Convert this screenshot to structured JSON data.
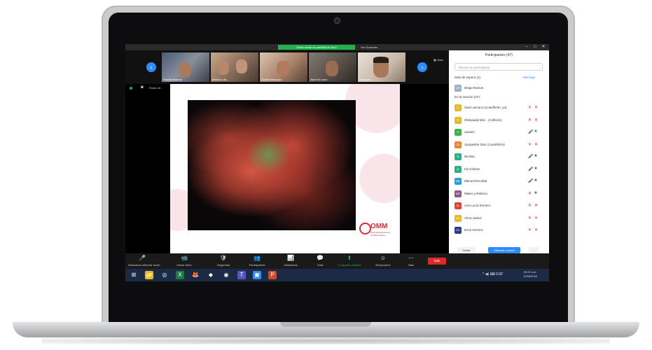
{
  "zoom": {
    "share_banner": "Estás viendo la pantalla de Saúl",
    "view_options": "Ver Opciones",
    "window_controls": [
      "–",
      "□",
      "✕"
    ],
    "view_toggle": "Vista",
    "thumbnails": [
      {
        "name": "Familia Ramos"
      },
      {
        "name": "Melina y Ali..."
      },
      {
        "name": "Cecilia Moncayo"
      },
      {
        "name": "Jose De Lara"
      },
      {
        "name": "Leonardo"
      }
    ],
    "share_indicator": "Estás vie...",
    "slide": {
      "logo_text": "OMM",
      "logo_sub": "Olimpiada Mexicana de Matemáticas"
    },
    "panel": {
      "title": "Participantes (47)",
      "search_placeholder": "Buscar un participante",
      "waiting_room": "Sala de espera (1)",
      "waiting_action": "Mensaje",
      "waiting_people": [
        {
          "name": "Diego Ramos",
          "initials": "DR",
          "color": "#9bb0c9"
        }
      ],
      "in_meeting": "En la reunión (47)",
      "participants": [
        {
          "name": "Saul Lazcano (Coanfitrión, yo)",
          "initials": "S",
          "color": "#e6b92e",
          "mic": "✕",
          "cam": "✕"
        },
        {
          "name": "Olimpiada Mat... (Anfitrión)",
          "initials": "O",
          "color": "#e6b92e",
          "mic": "✕",
          "cam": "✕"
        },
        {
          "name": "usuario",
          "initials": "U",
          "color": "#3cb34a",
          "mic": "🎤",
          "cam": "■"
        },
        {
          "name": "Jacqueline Diaz (Coanfitrión)",
          "initials": "JD",
          "color": "#e8872c",
          "mic": "✕",
          "cam": "✕"
        },
        {
          "name": "Nicolas",
          "initials": "N",
          "color": "#2faf83",
          "mic": "🎤",
          "cam": "■"
        },
        {
          "name": "Iris Chávez",
          "initials": "IC",
          "color": "#2faf83",
          "mic": "🎤",
          "cam": "■"
        },
        {
          "name": "Manuel Escobar",
          "initials": "ME",
          "color": "#2d9cdb",
          "mic": "🎤",
          "cam": "■"
        },
        {
          "name": "Mateo y Rebeca",
          "initials": "MR",
          "color": "#8b5a8a",
          "mic": "✕",
          "cam": "■"
        },
        {
          "name": "Ana Lucía Romero",
          "initials": "AL",
          "color": "#e0453a",
          "mic": "✕",
          "cam": "✕"
        },
        {
          "name": "Alma Juárez",
          "initials": "AJ",
          "color": "#e6b92e",
          "mic": "✕",
          "cam": "✕"
        },
        {
          "name": "Erick Herrera",
          "initials": "EH",
          "color": "#2d3a8c",
          "mic": "✕",
          "cam": "✕"
        }
      ],
      "invite": "Invitar",
      "mute_all": "Silenciar a todos",
      "more": "..."
    },
    "toolbar": [
      {
        "label": "Desactivar silenciar audio",
        "icon": "🎤"
      },
      {
        "label": "Iniciar video",
        "icon": "📹"
      },
      {
        "label": "Seguridad",
        "icon": "🛡"
      },
      {
        "label": "Participantes",
        "icon": "👥"
      },
      {
        "label": "Votaciones",
        "icon": "📊"
      },
      {
        "label": "Chat",
        "icon": "💬"
      },
      {
        "label": "Compartir pantalla",
        "icon": "⬆"
      },
      {
        "label": "Reacciones",
        "icon": "☺"
      },
      {
        "label": "Más",
        "icon": "⋯"
      }
    ],
    "end": "Salir",
    "taskbar": {
      "apps": [
        "⊞",
        "📁",
        "◎",
        "X",
        "🦊",
        "◆",
        "◉",
        "T",
        "▣",
        "P"
      ],
      "tray": "^ ◀) ⌨ ESP",
      "time": "09:22 a.m.",
      "date": "12/06/2020"
    }
  },
  "colors": {
    "accent": "#2d8cff",
    "share_green": "#23b14d",
    "end_red": "#e02828",
    "omm_red": "#d62f3b"
  }
}
